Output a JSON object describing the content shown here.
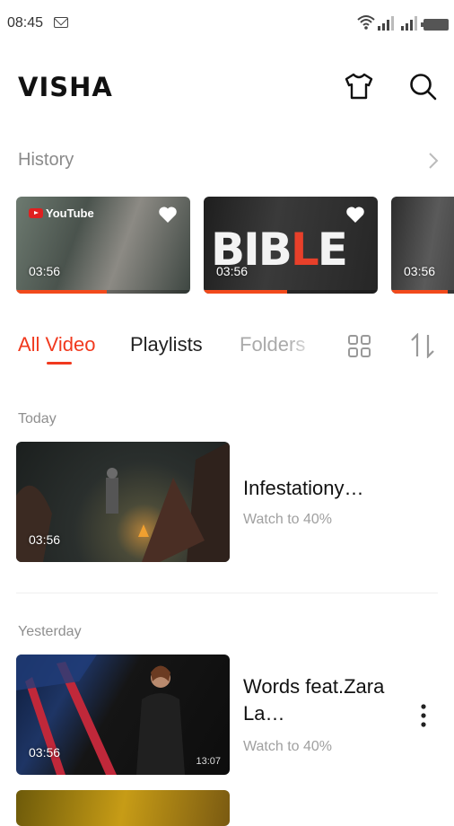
{
  "status_bar": {
    "time": "08:45"
  },
  "app": {
    "logo": "VISHA"
  },
  "history": {
    "title": "History",
    "items": [
      {
        "duration": "03:56",
        "badge": "YouTube",
        "progress": 0.52
      },
      {
        "duration": "03:56",
        "art_text": "BIBLE",
        "progress": 0.48
      },
      {
        "duration": "03:56",
        "progress": 0.7
      }
    ]
  },
  "tabs": {
    "all_video": "All Video",
    "playlists": "Playlists",
    "folders": "Folders"
  },
  "video_list": {
    "today_label": "Today",
    "yesterday_label": "Yesterday",
    "videos": [
      {
        "title": "Infestationy…",
        "meta": "Watch to 40%",
        "duration": "03:56"
      },
      {
        "title": "Words feat.Zara La…",
        "meta": "Watch to 40%",
        "duration": "03:56",
        "length": "13:07"
      }
    ]
  },
  "colors": {
    "accent": "#f1391e",
    "progress": "#f24a1c"
  }
}
